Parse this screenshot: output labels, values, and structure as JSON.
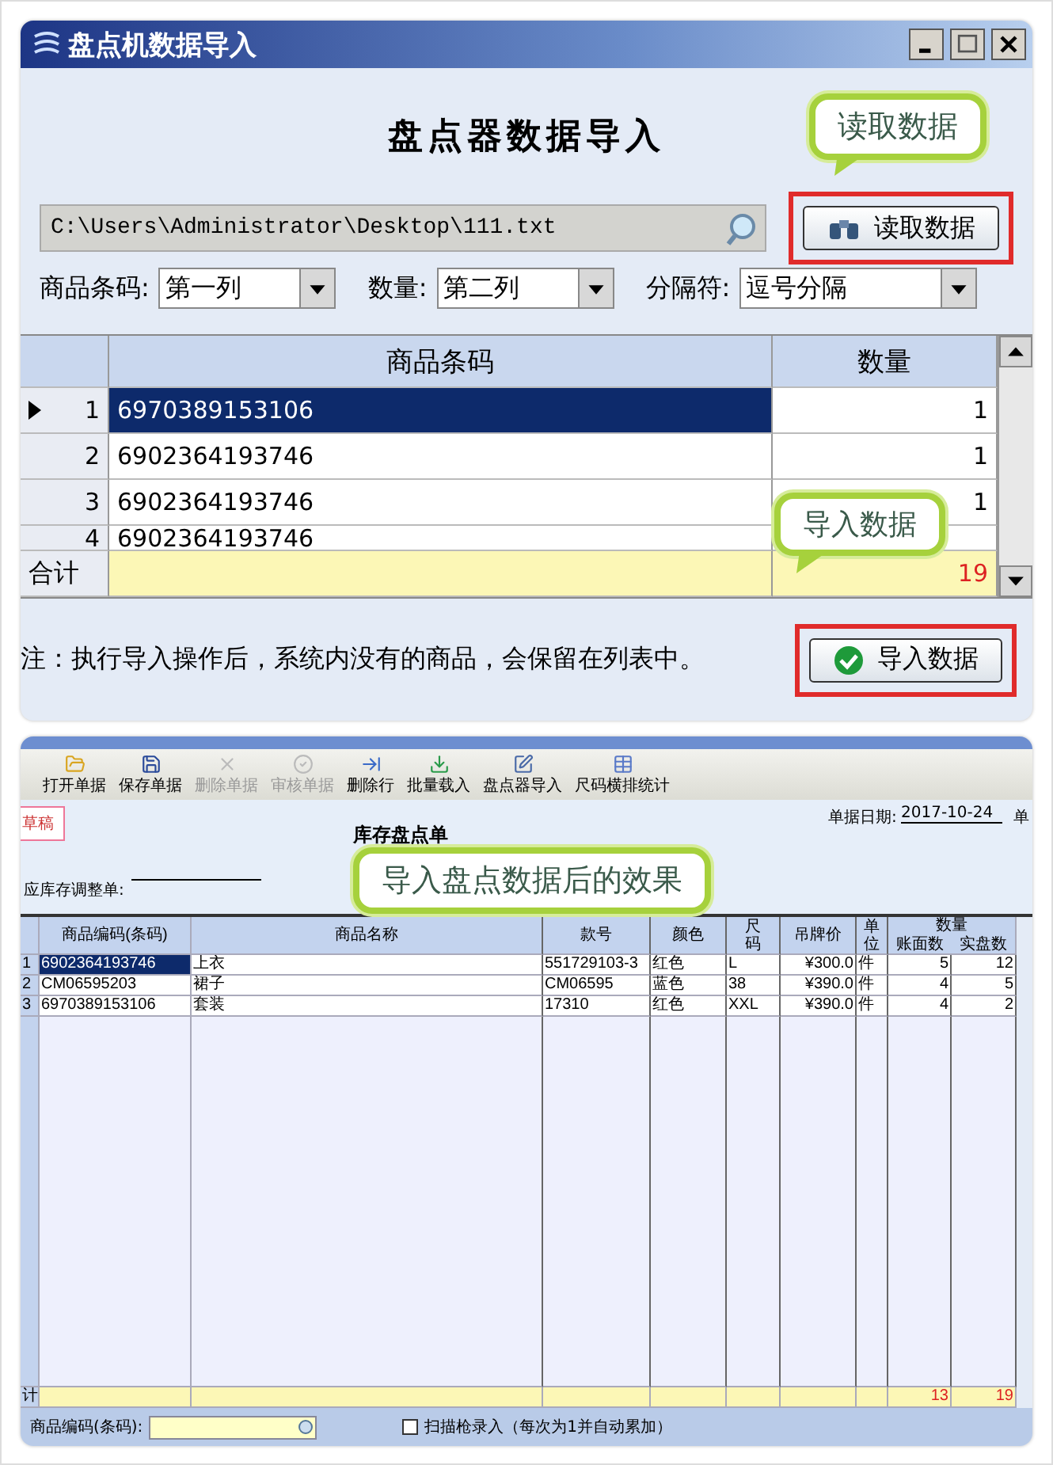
{
  "import_dialog": {
    "title": "盘点机数据导入",
    "heading": "盘点器数据导入",
    "file_path": "C:\\Users\\Administrator\\Desktop\\111.txt",
    "read_button": "读取数据",
    "read_callout": "读取数据",
    "selectors": [
      {
        "label": "商品条码:",
        "value": "第一列"
      },
      {
        "label": "数量:",
        "value": "第二列"
      },
      {
        "label": "分隔符:",
        "value": "逗号分隔"
      }
    ],
    "grid": {
      "columns": [
        "商品条码",
        "数量"
      ],
      "rows": [
        {
          "index": "1",
          "barcode": "6970389153106",
          "quantity": "1",
          "selected": true
        },
        {
          "index": "2",
          "barcode": "6902364193746",
          "quantity": "1",
          "selected": false
        },
        {
          "index": "3",
          "barcode": "6902364193746",
          "quantity": "1",
          "selected": false
        },
        {
          "index": "4",
          "barcode": "6902364193746",
          "selected": false
        }
      ],
      "total": {
        "label": "合计",
        "quantity": "19"
      }
    },
    "import_callout": "导入数据",
    "note": "注：执行导入操作后，系统内没有的商品，会保留在列表中。",
    "import_button": "导入数据"
  },
  "result_screen": {
    "toolbar": [
      {
        "label": "打开单据",
        "disabled": false
      },
      {
        "label": "保存单据",
        "disabled": false
      },
      {
        "label": "删除单据",
        "disabled": true
      },
      {
        "label": "审核单据",
        "disabled": true
      },
      {
        "label": "删除行",
        "disabled": false
      },
      {
        "label": "批量载入",
        "disabled": false
      },
      {
        "label": "盘点器导入",
        "disabled": false
      },
      {
        "label": "尺码横排统计",
        "disabled": false
      }
    ],
    "status_tag": "草稿",
    "title": "库存盘点单",
    "date_label": "单据日期:",
    "date_value": "2017-10-24",
    "edge_label": "单",
    "adjust_label": "应库存调整单:",
    "callout": "导入盘点数据后的效果",
    "table": {
      "columns": [
        "商品编码(条码)",
        "商品名称",
        "款号",
        "颜色",
        "尺码",
        "吊牌价",
        "单位"
      ],
      "quantity_group": "数量",
      "quantity_columns": [
        "账面数",
        "实盘数"
      ],
      "rows": [
        {
          "index": "1",
          "cells": [
            "6902364193746",
            "上衣",
            "551729103-3",
            "红色",
            "L",
            "¥300.0",
            "件",
            "5",
            "12"
          ],
          "selected": true
        },
        {
          "index": "2",
          "cells": [
            "CM06595203",
            "裙子",
            "CM06595",
            "蓝色",
            "38",
            "¥390.0",
            "件",
            "4",
            "5"
          ],
          "selected": false
        },
        {
          "index": "3",
          "cells": [
            "6970389153106",
            "套装",
            "17310",
            "红色",
            "XXL",
            "¥390.0",
            "件",
            "4",
            "2"
          ],
          "selected": false
        }
      ],
      "total": {
        "label": "计",
        "stock": "13",
        "actual": "19"
      }
    },
    "barcode_label": "商品编码(条码):",
    "scan_checkbox": {
      "label": "扫描枪录入（每次为1并自动累加）",
      "checked": false
    }
  }
}
